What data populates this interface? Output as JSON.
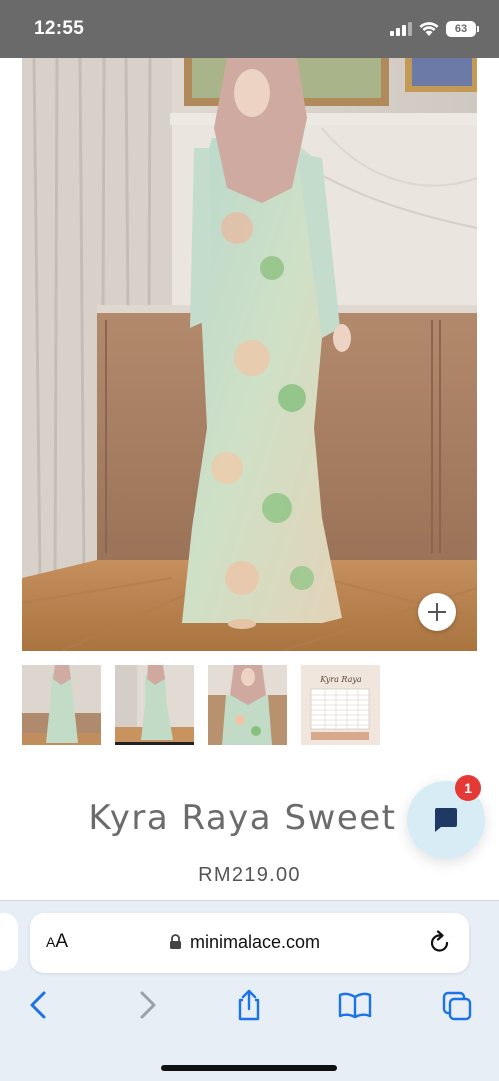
{
  "status_bar": {
    "time": "12:55",
    "battery": "63",
    "icons": [
      "cellular-signal-icon",
      "wifi-icon",
      "battery-icon"
    ]
  },
  "product": {
    "hero_image_alt": "model wearing floral kurung",
    "thumbnails": [
      {
        "name": "front-view"
      },
      {
        "name": "side-view"
      },
      {
        "name": "detail-view"
      },
      {
        "name": "size-chart"
      }
    ],
    "size_chart_brand": "Kyra Raya",
    "title": "Kyra Raya Sweet Mi",
    "price": "RM219.00"
  },
  "chat": {
    "badge_count": "1"
  },
  "browser": {
    "aa_label_small": "A",
    "aa_label_big": "A",
    "url": "minimalace.com",
    "toolbar": [
      "back-icon",
      "forward-icon",
      "share-icon",
      "bookmarks-icon",
      "tabs-icon"
    ]
  },
  "colors": {
    "accent_blue": "#1a73e8",
    "badge_red": "#e53935",
    "chat_bg": "#d8ecf6",
    "status_bar_bg": "#6a6a6a"
  }
}
